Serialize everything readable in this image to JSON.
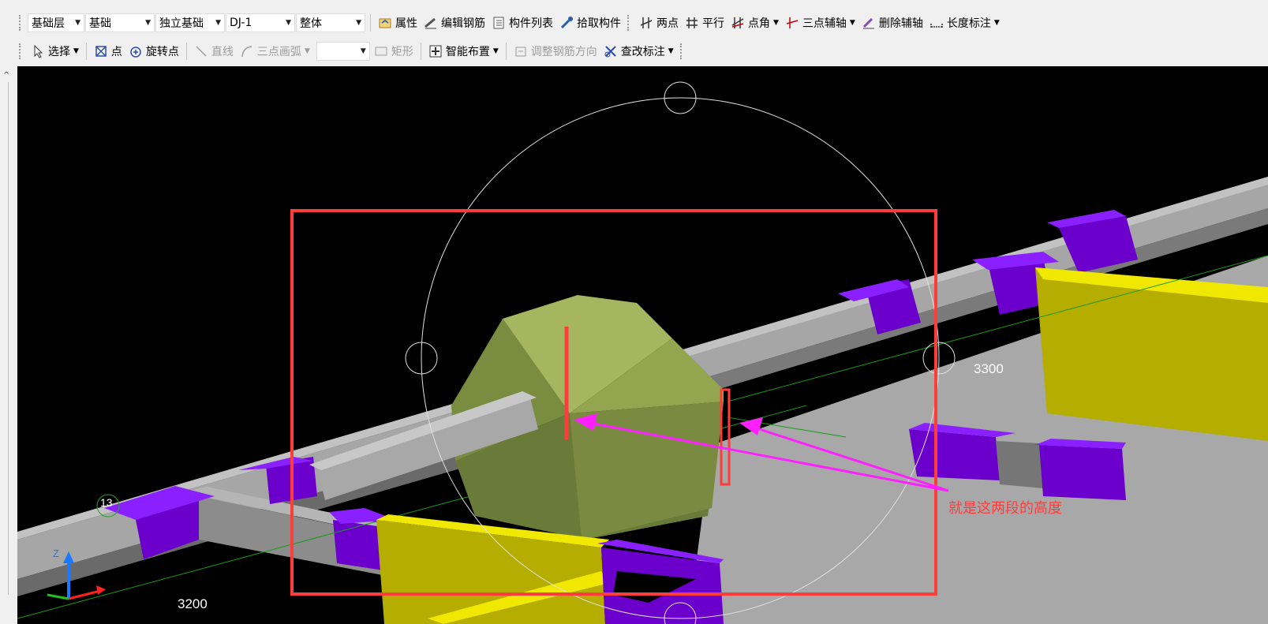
{
  "toolbar_top_partial": true,
  "toolbar1": {
    "floor_select": "基础层",
    "category_select": "基础",
    "type_select": "独立基础",
    "element_select": "DJ-1",
    "scope_select": "整体",
    "property_label": "属性",
    "edit_rebar_label": "编辑钢筋",
    "component_list_label": "构件列表",
    "pick_component_label": "拾取构件",
    "two_point_label": "两点",
    "parallel_label": "平行",
    "point_angle_label": "点角",
    "three_point_axis_label": "三点辅轴",
    "delete_axis_label": "删除辅轴",
    "length_dim_label": "长度标注"
  },
  "toolbar2": {
    "select_label": "选择",
    "point_label": "点",
    "rotate_point_label": "旋转点",
    "line_label": "直线",
    "arc_label": "三点画弧",
    "empty_select": "",
    "rect_label": "矩形",
    "smart_layout_label": "智能布置",
    "adjust_rebar_label": "调整钢筋方向",
    "edit_dim_label": "查改标注"
  },
  "viewport": {
    "dim_right": "3300",
    "dim_bottom": "3200",
    "axis_tag": "13",
    "annotation": "就是这两段的高度",
    "axis_z": "Z"
  },
  "colors": {
    "beam": "#a6a6a6",
    "column": "#6b00cc",
    "foundation": "#8c9a48",
    "slab": "#c8c000",
    "annotation_box": "#ff3c3c",
    "arrow": "#ff20ff"
  }
}
